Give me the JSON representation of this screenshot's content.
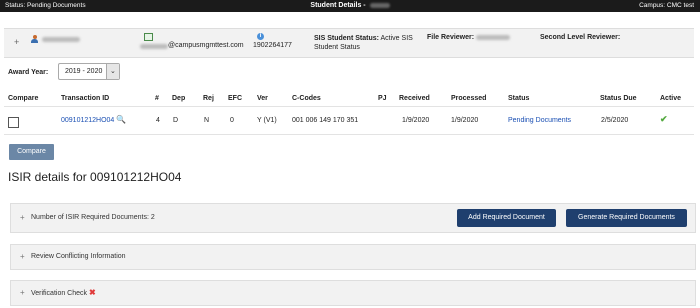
{
  "topbar": {
    "status": "Status: Pending Documents",
    "title": "Student Details - ",
    "campus": "Campus: CMC test"
  },
  "student": {
    "email_suffix": "@campusmgmttest.com",
    "phone": "1902264177",
    "sis_status_label": "SIS Student Status:",
    "sis_status_value": "Active SIS",
    "sis_status_value2": "Student Status",
    "file_reviewer_label": "File Reviewer:",
    "second_reviewer_label": "Second Level Reviewer:"
  },
  "award_year": {
    "label": "Award Year:",
    "selected": "2019 - 2020"
  },
  "table": {
    "headers": {
      "compare": "Compare",
      "transaction_id": "Transaction ID",
      "num": "#",
      "dep": "Dep",
      "rej": "Rej",
      "efc": "EFC",
      "ver": "Ver",
      "ccodes": "C-Codes",
      "pj": "PJ",
      "received": "Received",
      "processed": "Processed",
      "status": "Status",
      "status_due": "Status Due",
      "active": "Active"
    },
    "rows": [
      {
        "transaction_id": "009101212HO04",
        "num": "4",
        "dep": "D",
        "rej": "N",
        "efc": "0",
        "ver": "Y (V1)",
        "ccodes": "001 006 149 170 351",
        "pj": "",
        "received": "1/9/2020",
        "processed": "1/9/2020",
        "status": "Pending Documents",
        "status_due": "2/5/2020",
        "active": true
      }
    ]
  },
  "compare_button": "Compare",
  "isir_title": "ISIR details for 009101212HO04",
  "panels": {
    "required_docs": "Number of ISIR Required Documents: 2",
    "add_required": "Add Required Document",
    "generate_required": "Generate Required Documents",
    "review_conflicting": "Review Conflicting Information",
    "verification_check": "Verification Check"
  },
  "colors": {
    "topbar_bg": "#1b1b1b",
    "link": "#1a4fb3",
    "primary_button": "#1f3f6e",
    "compare_button": "#6b87a6",
    "active_check": "#53a93f",
    "error_x": "#e03a3a"
  }
}
